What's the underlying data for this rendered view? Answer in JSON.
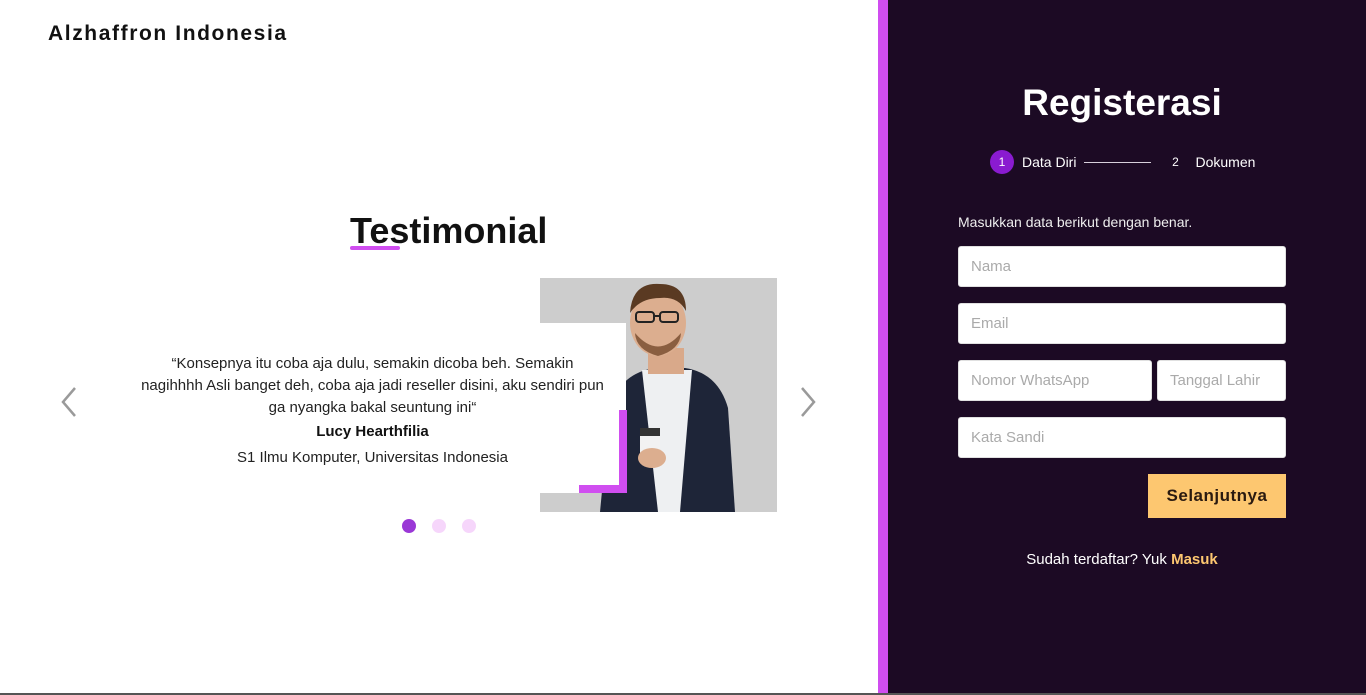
{
  "brand": "Alzhaffron Indonesia",
  "testimonial": {
    "title": "Testimonial",
    "quote": "“Konsepnya itu coba aja dulu, semakin dicoba beh. Semakin nagihhhh Asli banget deh, coba aja jadi reseller disini, aku sendiri pun ga nyangka bakal seuntung ini“",
    "name": "Lucy Hearthfilia",
    "role": "S1 Ilmu Komputer, Universitas Indonesia",
    "slides_total": 3,
    "active_slide": 1
  },
  "registration": {
    "title": "Registerasi",
    "steps": [
      {
        "number": "1",
        "label": "Data Diri"
      },
      {
        "number": "2",
        "label": "Dokumen"
      }
    ],
    "instruction": "Masukkan data berikut dengan benar.",
    "fields": {
      "nama": "Nama",
      "email": "Email",
      "whatsapp": "Nomor WhatsApp",
      "tanggal_lahir": "Tanggal Lahir",
      "kata_sandi": "Kata Sandi"
    },
    "next_label": "Selanjutnya",
    "login_prompt": "Sudah terdaftar? Yuk ",
    "login_link": "Masuk"
  },
  "colors": {
    "accent": "#d04ef0",
    "panel_bg": "#1c0a24",
    "step_active": "#8a1bd0",
    "button": "#fdc770",
    "dot_active": "#9a38d6",
    "dot_inactive": "#f6d6fb"
  },
  "icons": {
    "prev": "chevron-left-icon",
    "next": "chevron-right-icon"
  }
}
